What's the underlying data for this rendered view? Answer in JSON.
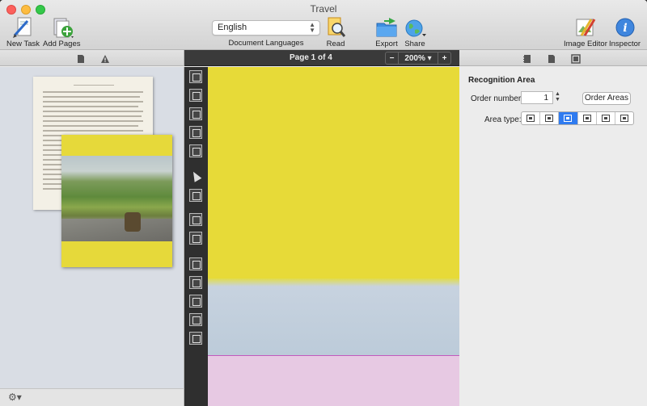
{
  "window": {
    "title": "Travel"
  },
  "toolbar": {
    "new_task": "New Task",
    "add_pages": "Add Pages",
    "language_value": "English",
    "language_label": "Document Languages",
    "read": "Read",
    "export": "Export",
    "share": "Share",
    "image_editor": "Image Editor",
    "inspector": "Inspector"
  },
  "viewer": {
    "page_indicator": "Page 1 of 4",
    "zoom_minus": "−",
    "zoom_value": "200% ▾",
    "zoom_plus": "+"
  },
  "inspector": {
    "title": "Recognition Area",
    "order_label": "Order number:",
    "order_value": "1",
    "order_button": "Order Areas",
    "area_type_label": "Area type:",
    "area_types": [
      "text-area",
      "table-area",
      "picture-area",
      "barcode-area",
      "background-picture-area",
      "recognition-area"
    ],
    "active_area_type": 2
  },
  "colors": {
    "accent": "#2f7bf0",
    "page_yellow": "#e7da38",
    "area_magenta": "#c25bbd"
  }
}
